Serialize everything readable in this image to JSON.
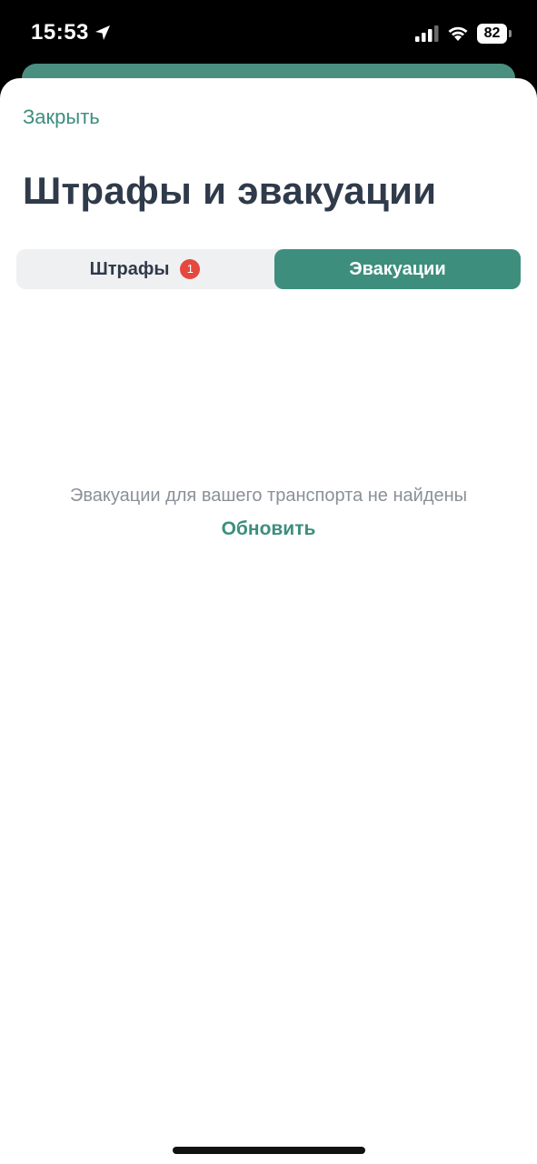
{
  "status_bar": {
    "time": "15:53",
    "battery": "82",
    "icons": [
      "location-arrow-icon",
      "cellular-signal-icon",
      "wifi-icon",
      "battery-icon"
    ]
  },
  "header": {
    "close_label": "Закрыть",
    "title": "Штрафы и эвакуации"
  },
  "tabs": [
    {
      "label": "Штрафы",
      "badge": "1",
      "active": false
    },
    {
      "label": "Эвакуации",
      "active": true
    }
  ],
  "empty_state": {
    "message": "Эвакуации для вашего транспорта не найдены",
    "refresh_label": "Обновить"
  },
  "colors": {
    "accent": "#3e8e7e",
    "title": "#2f3a4a",
    "badge": "#e5483d",
    "muted_text": "#8a9098",
    "segment_bg": "#eff0f2"
  }
}
